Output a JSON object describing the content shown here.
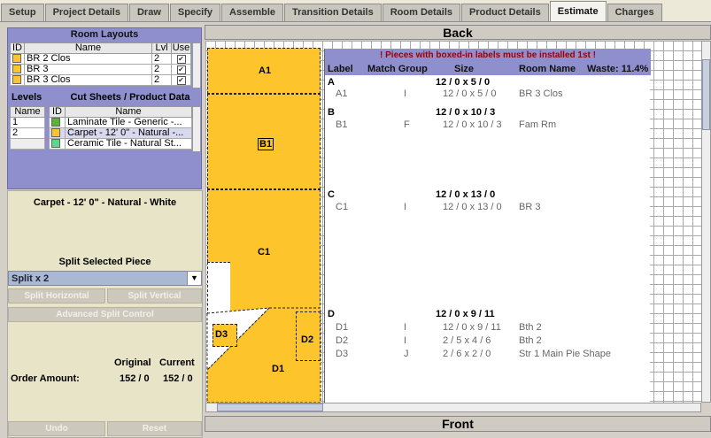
{
  "tabs": [
    "Setup",
    "Project Details",
    "Draw",
    "Specify",
    "Assemble",
    "Transition Details",
    "Room Details",
    "Product Details",
    "Estimate",
    "Charges"
  ],
  "active_tab": "Estimate",
  "room_layouts": {
    "title": "Room Layouts",
    "headers": [
      "ID",
      "Name",
      "Lvl",
      "Use"
    ],
    "rows": [
      {
        "name": "BR 2 Clos",
        "lvl": "2",
        "use": "✔",
        "color": "#fdc42c"
      },
      {
        "name": "BR 3",
        "lvl": "2",
        "use": "✔",
        "color": "#fdc42c"
      },
      {
        "name": "BR 3 Clos",
        "lvl": "2",
        "use": "✔",
        "color": "#fdc42c"
      }
    ]
  },
  "levels": {
    "title": "Levels",
    "header": "Name",
    "rows": [
      "1",
      "2",
      ""
    ]
  },
  "cut_sheets": {
    "title": "Cut Sheets / Product Data",
    "headers": [
      "ID",
      "Name"
    ],
    "rows": [
      {
        "name": "Laminate Tile - Generic -...",
        "color": "#5cb531"
      },
      {
        "name": "Carpet - 12' 0\" - Natural -...",
        "color": "#fdc42c"
      },
      {
        "name": "Ceramic Tile - Natural St...",
        "color": "#5ad88c"
      }
    ]
  },
  "selected_product": "Carpet - 12' 0\" - Natural - White",
  "split": {
    "title": "Split Selected Piece",
    "selected": "Split x 2",
    "horizontal": "Split Horizontal",
    "vertical": "Split Vertical",
    "advanced": "Advanced Split Control"
  },
  "order": {
    "original_label": "Original",
    "current_label": "Current",
    "label": "Order Amount:",
    "original": "152 / 0",
    "current": "152 / 0"
  },
  "undo": "Undo",
  "reset": "Reset",
  "back_label": "Back",
  "front_label": "Front",
  "pieces": {
    "A1": "A1",
    "B1": "B1",
    "C1": "C1",
    "D1": "D1",
    "D2": "D2",
    "D3": "D3"
  },
  "report": {
    "warning": "! Pieces with boxed-in labels must be installed 1st !",
    "headers": {
      "label": "Label",
      "match": "Match Group",
      "size": "Size",
      "room": "Room Name",
      "waste": "Waste: 11.4%"
    },
    "groups": [
      {
        "label": "A",
        "size": "12 / 0 x 5 / 0",
        "items": [
          {
            "label": "A1",
            "match": "I",
            "size": "12 / 0 x 5 / 0",
            "room": "BR 3 Clos"
          }
        ]
      },
      {
        "label": "B",
        "size": "12 / 0 x 10 / 3",
        "items": [
          {
            "label": "B1",
            "match": "F",
            "size": "12 / 0 x 10 / 3",
            "room": "Fam Rm"
          }
        ]
      },
      {
        "label": "C",
        "size": "12 / 0 x 13 / 0",
        "items": [
          {
            "label": "C1",
            "match": "I",
            "size": "12 / 0 x 13 / 0",
            "room": "BR 3"
          }
        ]
      },
      {
        "label": "D",
        "size": "12 / 0 x 9 / 11",
        "items": [
          {
            "label": "D1",
            "match": "I",
            "size": "12 / 0 x 9 / 11",
            "room": "Bth 2"
          },
          {
            "label": "D2",
            "match": "I",
            "size": "2 / 5 x 4 / 6",
            "room": "Bth 2"
          },
          {
            "label": "D3",
            "match": "J",
            "size": "2 / 6 x 2 / 0",
            "room": "Str 1 Main  Pie Shape"
          }
        ]
      }
    ]
  }
}
